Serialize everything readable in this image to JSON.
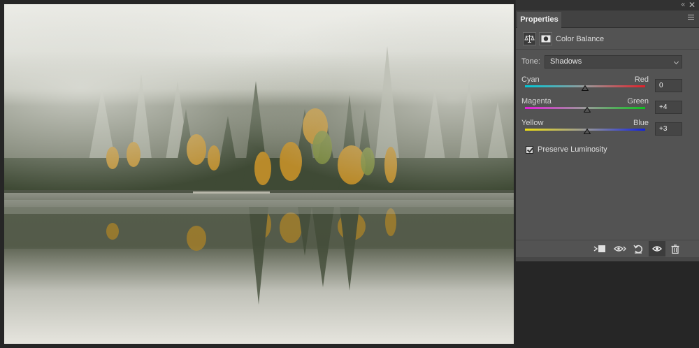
{
  "window": {
    "collapse_glyph": "«",
    "close_glyph": "✕"
  },
  "panel": {
    "tab_label": "Properties",
    "menu_icon": "hamburger-menu-icon",
    "adjustment": {
      "title": "Color Balance",
      "icons": [
        "color-balance-scale-icon",
        "layer-mask-icon"
      ]
    },
    "tone": {
      "label": "Tone:",
      "selected": "Shadows"
    },
    "sliders": [
      {
        "left_label": "Cyan",
        "right_label": "Red",
        "value": "0",
        "level": 0,
        "gradient_from": "#00c8d8",
        "gradient_to": "#e0202a"
      },
      {
        "left_label": "Magenta",
        "right_label": "Green",
        "value": "+4",
        "level": 4,
        "gradient_from": "#e020d8",
        "gradient_to": "#10c020"
      },
      {
        "left_label": "Yellow",
        "right_label": "Blue",
        "value": "+3",
        "level": 3,
        "gradient_from": "#f0e010",
        "gradient_to": "#1020e0"
      }
    ],
    "preserve_luminosity": {
      "label": "Preserve Luminosity",
      "checked": true
    },
    "footer_icons": [
      "clip-to-layer-icon",
      "view-previous-state-icon",
      "reset-icon",
      "visibility-eye-icon",
      "delete-trash-icon"
    ]
  },
  "colors": {
    "panel_bg": "#535353",
    "app_bg": "#262626",
    "accent_field": "#454545"
  }
}
